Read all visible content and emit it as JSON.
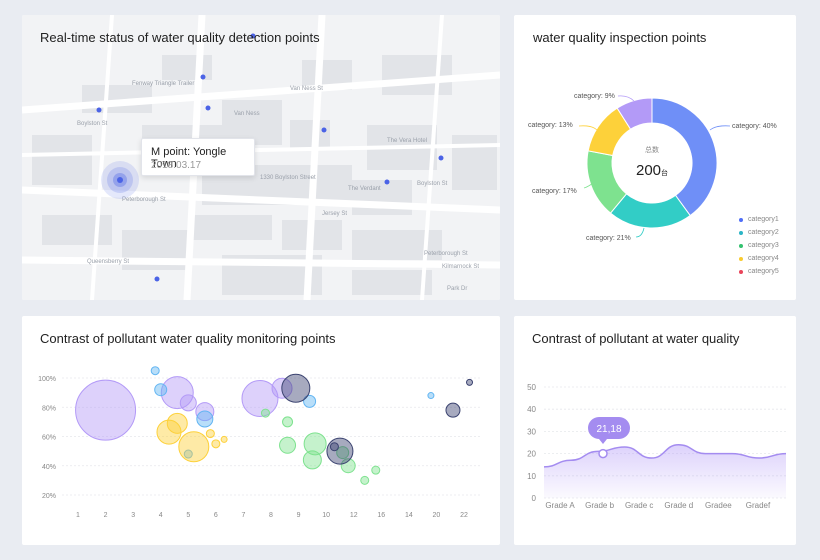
{
  "map_card": {
    "title": "Real-time status of water quality detection points",
    "tooltip": {
      "title": "M point: Yongle Town",
      "date": "2018.03.17"
    },
    "street_labels": [
      "Boylston St",
      "Van Ness St",
      "Van Ness",
      "Peterborough St",
      "The Vera Hotel",
      "1330 Boylston Street",
      "The Verdant",
      "Boylston St",
      "Jersey St",
      "Peterborough St",
      "Queensberry St",
      "Kilmarnock St",
      "Park Dr",
      "Fenway Triangle Trailer"
    ],
    "marker_color": "#4b63e6"
  },
  "donut_card": {
    "title": "water quality inspection points",
    "center_label": "总数",
    "center_value": "200",
    "center_unit": "台",
    "slice_labels": [
      "category: 40%",
      "category: 21%",
      "category: 17%",
      "category: 13%",
      "category: 9%"
    ],
    "legend": [
      "category1",
      "category2",
      "category3",
      "category4",
      "category5"
    ],
    "colors": [
      "#6f8ff7",
      "#32cdc6",
      "#7ee28f",
      "#fdd13a",
      "#b39af7"
    ],
    "legend_colors": [
      "#4f6ef7",
      "#2bb5c6",
      "#34c26f",
      "#f9cb2f",
      "#e9445a"
    ]
  },
  "bubble_card": {
    "title": "Contrast of pollutant water quality monitoring points"
  },
  "line_card": {
    "title": "Contrast of pollutant  at water quality",
    "badge": "21,18"
  },
  "chart_data": [
    {
      "type": "pie",
      "labels": [
        "category1",
        "category2",
        "category3",
        "category4",
        "category5"
      ],
      "values": [
        40,
        21,
        17,
        13,
        9
      ],
      "center_total": 200,
      "legend_position": "bottom-right"
    },
    {
      "type": "scatter",
      "title": "Contrast of pollutant water quality monitoring points",
      "x_ticks": [
        "1",
        "2",
        "3",
        "4",
        "5",
        "6",
        "7",
        "8",
        "9",
        "10",
        "12",
        "16",
        "14",
        "20",
        "22"
      ],
      "y_ticks": [
        "100%",
        "80%",
        "60%",
        "40%",
        "20%"
      ],
      "ylim": [
        20,
        100
      ],
      "grid": true,
      "series": [
        {
          "color": "#b39af7",
          "points": [
            [
              2,
              78,
              30
            ],
            [
              4.6,
              90,
              16
            ],
            [
              5,
              83,
              8
            ],
            [
              5.6,
              77,
              9
            ],
            [
              7.6,
              86,
              18
            ],
            [
              8.4,
              93,
              10
            ]
          ]
        },
        {
          "color": "#62b5f2",
          "points": [
            [
              3.8,
              105,
              4
            ],
            [
              4,
              92,
              6
            ],
            [
              5.6,
              72,
              8
            ],
            [
              5,
              48,
              4
            ],
            [
              9.4,
              84,
              6
            ],
            [
              13.8,
              88,
              3
            ]
          ]
        },
        {
          "color": "#fdd13a",
          "points": [
            [
              4.3,
              63,
              12
            ],
            [
              4.6,
              69,
              10
            ],
            [
              5.2,
              53,
              15
            ],
            [
              5.8,
              62,
              4
            ],
            [
              6,
              55,
              4
            ],
            [
              6.3,
              58,
              3
            ]
          ]
        },
        {
          "color": "#7ee28f",
          "points": [
            [
              7.8,
              76,
              4
            ],
            [
              8.6,
              70,
              5
            ],
            [
              8.6,
              54,
              8
            ],
            [
              9.6,
              55,
              11
            ],
            [
              9.5,
              44,
              9
            ],
            [
              10.6,
              49,
              6
            ],
            [
              10.8,
              40,
              7
            ],
            [
              11.4,
              30,
              4
            ],
            [
              11.8,
              37,
              4
            ]
          ]
        },
        {
          "color": "#3b4370",
          "points": [
            [
              8.9,
              93,
              14
            ],
            [
              10.3,
              53,
              4
            ],
            [
              10.5,
              50,
              13
            ],
            [
              14.6,
              78,
              7
            ],
            [
              15.2,
              97,
              3
            ]
          ]
        }
      ]
    },
    {
      "type": "line",
      "title": "Contrast of pollutant  at water quality",
      "categories": [
        "Grade A",
        "Grade b",
        "Grade c",
        "Grade d",
        "Gradee",
        "Gradef"
      ],
      "y_ticks": [
        0,
        10,
        20,
        30,
        40,
        50
      ],
      "ylim": [
        0,
        50
      ],
      "series": [
        {
          "values": [
            14,
            17,
            21,
            23,
            18,
            24,
            20,
            20,
            18,
            20
          ]
        }
      ],
      "highlight": {
        "category": "Grade b",
        "value": 20,
        "label": "21,18"
      }
    }
  ]
}
